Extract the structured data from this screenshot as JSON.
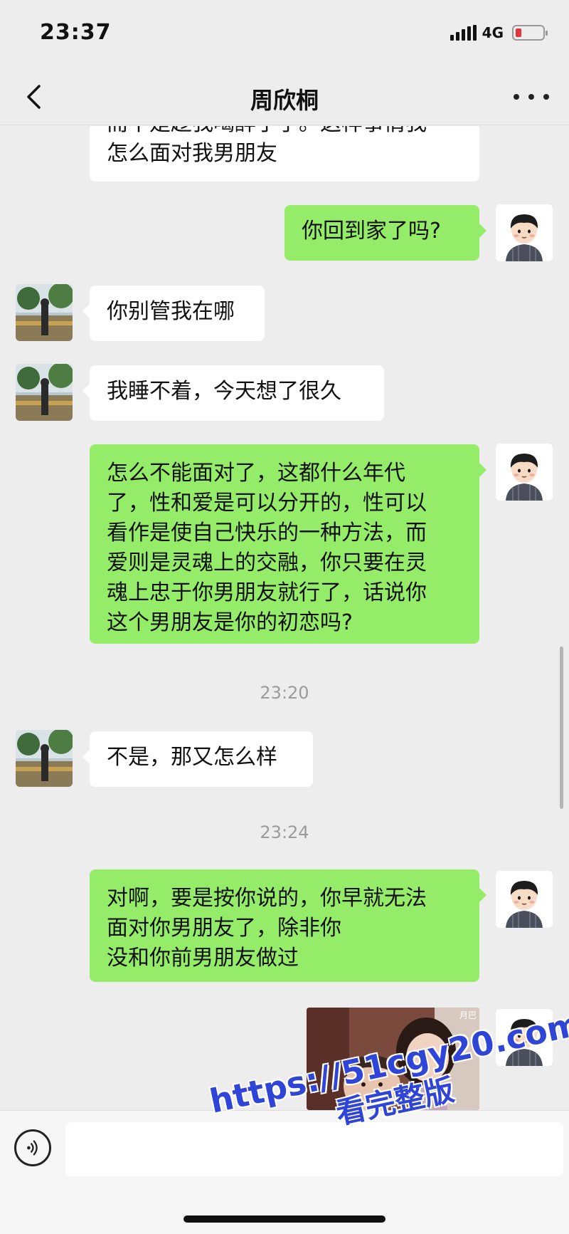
{
  "status_bar": {
    "time": "23:37",
    "network": "4G"
  },
  "nav": {
    "title": "周欣桐"
  },
  "messages": [
    {
      "side": "in",
      "text": "而不是趁我喝醉了手。这样事情我\n怎么面对我男朋友"
    },
    {
      "side": "out",
      "text": "你回到家了吗?"
    },
    {
      "side": "in",
      "text": "你别管我在哪"
    },
    {
      "side": "in",
      "text": "我睡不着，今天想了很久"
    },
    {
      "side": "out",
      "text": "怎么不能面对了，这都什么年代\n了，性和爱是可以分开的，性可以\n看作是使自己快乐的一种方法，而\n爱则是灵魂上的交融，你只要在灵\n魂上忠于你男朋友就行了，话说你\n这个男朋友是你的初恋吗?"
    },
    {
      "side": "in",
      "text": "不是，那又怎么样"
    },
    {
      "side": "out",
      "text": "对啊，要是按你说的，你早就无法\n面对你男朋友了，除非你\n没和你前男朋友做过"
    }
  ],
  "timestamps": [
    "23:20",
    "23:24"
  ],
  "sticker": {
    "label": "月巴"
  },
  "input": {
    "placeholder": ""
  },
  "watermark": {
    "url": "https://51cgy20.com",
    "caption": "看完整版"
  },
  "colors": {
    "outgoing_bubble": "#95ec69",
    "incoming_bubble": "#ffffff",
    "background": "#ededed",
    "watermark": "#2f45d8"
  }
}
